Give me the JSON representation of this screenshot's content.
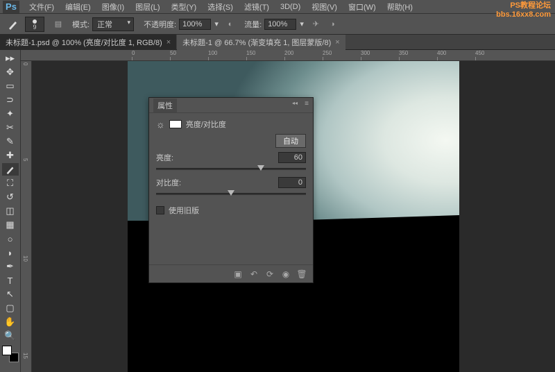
{
  "watermark": {
    "line1": "PS教程论坛",
    "line2": "bbs.16xx8.com"
  },
  "menu": {
    "logo": "Ps",
    "items": [
      "文件(F)",
      "编辑(E)",
      "图像(I)",
      "图层(L)",
      "类型(Y)",
      "选择(S)",
      "滤镜(T)",
      "3D(D)",
      "视图(V)",
      "窗口(W)",
      "帮助(H)"
    ]
  },
  "options": {
    "brush_preset_size": "9",
    "mode_label": "模式:",
    "mode_value": "正常",
    "opacity_label": "不透明度:",
    "opacity_value": "100%",
    "flow_label": "流量:",
    "flow_value": "100%"
  },
  "tabs": [
    {
      "label": "未标题-1.psd @ 100% (亮度/对比度 1, RGB/8)",
      "active": true
    },
    {
      "label": "未标题-1 @ 66.7% (渐变填充 1, 图层蒙版/8)",
      "active": false
    }
  ],
  "ruler_h": [
    "0",
    "50",
    "100",
    "150",
    "200",
    "250",
    "300",
    "350",
    "400",
    "450"
  ],
  "ruler_v": [
    "0",
    "5",
    "10",
    "15"
  ],
  "panel": {
    "title": "属性",
    "adj_name": "亮度/对比度",
    "auto": "自动",
    "brightness_label": "亮度:",
    "brightness_value": "60",
    "brightness_pos_pct": 70,
    "contrast_label": "对比度:",
    "contrast_value": "0",
    "contrast_pos_pct": 50,
    "legacy_label": "使用旧版"
  }
}
